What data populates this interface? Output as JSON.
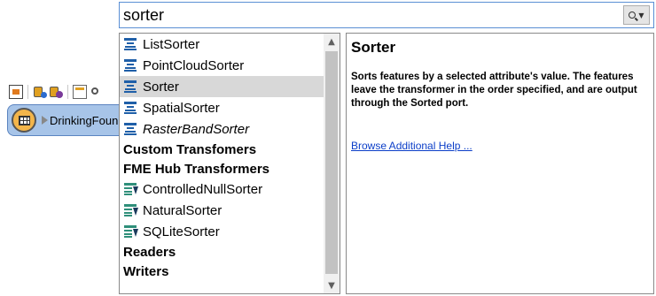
{
  "search": {
    "value": "sorter",
    "button_icon": "search-dropdown-icon"
  },
  "canvas": {
    "node_label": "DrinkingFoun",
    "toolbar_icons": [
      "add-reader-icon",
      "reader-config-icon",
      "feature-type-icon",
      "table-icon",
      "inspect-icon"
    ]
  },
  "results": {
    "items_top": [
      {
        "label": "ListSorter",
        "icon": "sorter-icon",
        "italic": false,
        "selected": false
      },
      {
        "label": "PointCloudSorter",
        "icon": "sorter-icon",
        "italic": false,
        "selected": false
      },
      {
        "label": "Sorter",
        "icon": "sorter-icon",
        "italic": false,
        "selected": true
      },
      {
        "label": "SpatialSorter",
        "icon": "sorter-icon",
        "italic": false,
        "selected": false
      },
      {
        "label": "RasterBandSorter",
        "icon": "sorter-icon",
        "italic": true,
        "selected": false
      }
    ],
    "header_custom": "Custom Transfomers",
    "header_hub": "FME Hub Transformers",
    "items_hub": [
      {
        "label": "ControlledNullSorter",
        "icon": "hub-sorter-icon"
      },
      {
        "label": "NaturalSorter",
        "icon": "hub-sorter-icon"
      },
      {
        "label": "SQLiteSorter",
        "icon": "hub-sorter-icon"
      }
    ],
    "header_readers": "Readers",
    "header_writers": "Writers"
  },
  "help": {
    "title": "Sorter",
    "description": "Sorts features by a selected attribute's value. The features leave the transformer in the order specified, and are output through the Sorted port.",
    "link": "Browse Additional Help ..."
  },
  "colors": {
    "accent_border": "#5a8fd4",
    "selection": "#d8d8d8",
    "link": "#0b3ec8",
    "node_fill": "#a7c4e8"
  }
}
